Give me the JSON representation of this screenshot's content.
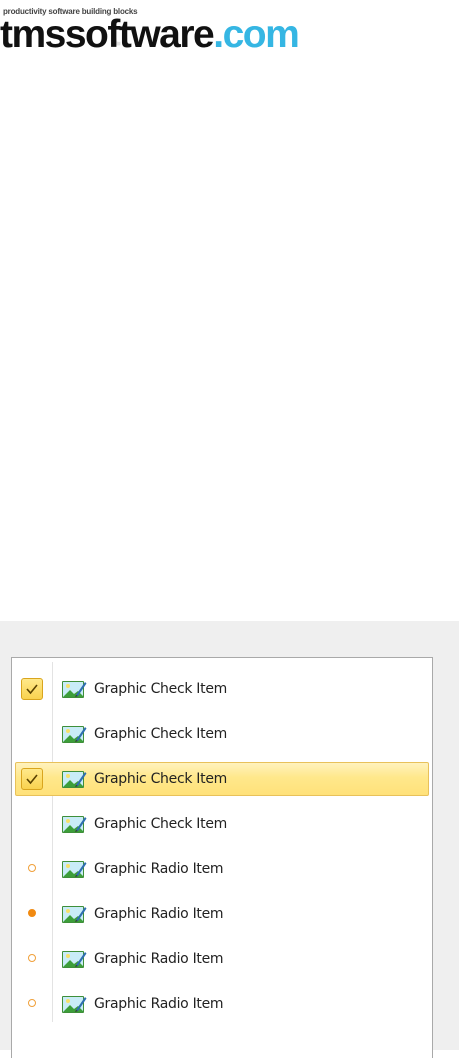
{
  "logo": {
    "tagline": "productivity software building blocks",
    "name_main": "tmssoftware",
    "name_suffix": ".com",
    "colors": {
      "main": "#111111",
      "suffix": "#35b6e3"
    }
  },
  "menu": {
    "items": [
      {
        "label": "Graphic Check Item",
        "kind": "check",
        "checked": true,
        "selected": false,
        "icon": "graphic-image-icon"
      },
      {
        "label": "Graphic Check Item",
        "kind": "check",
        "checked": false,
        "selected": false,
        "icon": "graphic-image-icon"
      },
      {
        "label": "Graphic Check Item",
        "kind": "check",
        "checked": true,
        "selected": true,
        "icon": "graphic-image-icon"
      },
      {
        "label": "Graphic Check Item",
        "kind": "check",
        "checked": false,
        "selected": false,
        "icon": "graphic-image-icon"
      },
      {
        "label": "Graphic Radio Item",
        "kind": "radio",
        "checked": false,
        "selected": false,
        "icon": "graphic-image-icon"
      },
      {
        "label": "Graphic Radio Item",
        "kind": "radio",
        "checked": true,
        "selected": false,
        "icon": "graphic-image-icon"
      },
      {
        "label": "Graphic Radio Item",
        "kind": "radio",
        "checked": false,
        "selected": false,
        "icon": "graphic-image-icon"
      },
      {
        "label": "Graphic Radio Item",
        "kind": "radio",
        "checked": false,
        "selected": false,
        "icon": "graphic-image-icon"
      }
    ],
    "colors": {
      "highlight": "#ffe88b",
      "check": "#f9d24e",
      "radio": "#f18a11"
    }
  }
}
